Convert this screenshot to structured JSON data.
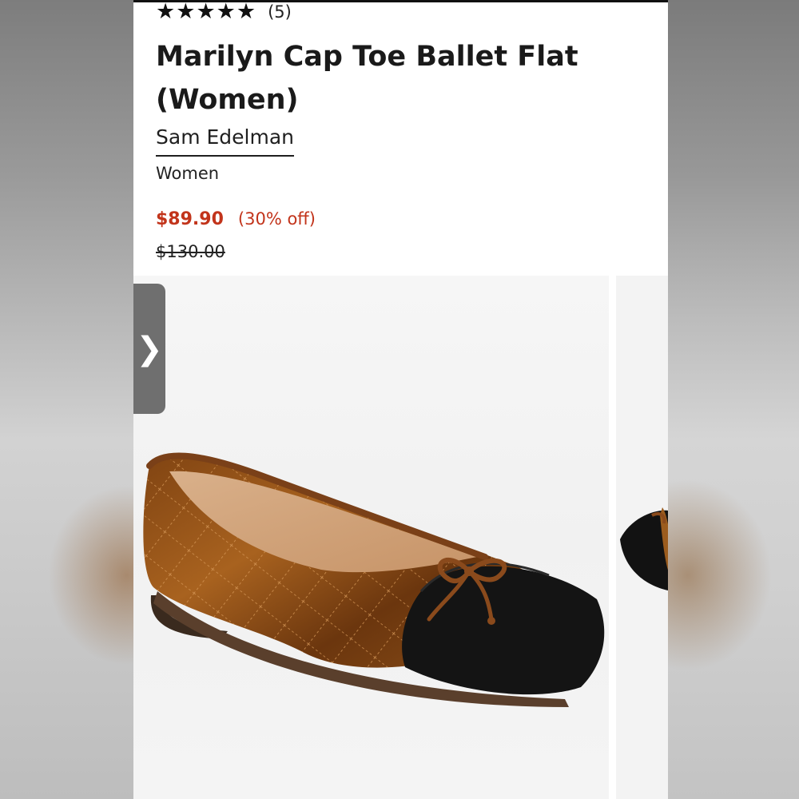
{
  "product": {
    "rating_count": "(5)",
    "title": "Marilyn Cap Toe Ballet Flat (Women)",
    "brand": "Sam Edelman",
    "category": "Women",
    "sale_price": "$89.90",
    "discount": "(30% off)",
    "original_price": "$130.00"
  },
  "rating": {
    "value": 5,
    "max": 5,
    "star_glyph": "★"
  },
  "gallery": {
    "next_glyph": "❯",
    "icons": [
      "chevron-right-icon"
    ]
  },
  "colors": {
    "sale_price": "#c2341b",
    "text": "#1a1a1a",
    "nav_button": "#6f6f6f",
    "velvet": "#8a4d18",
    "cap_toe": "#141414"
  }
}
